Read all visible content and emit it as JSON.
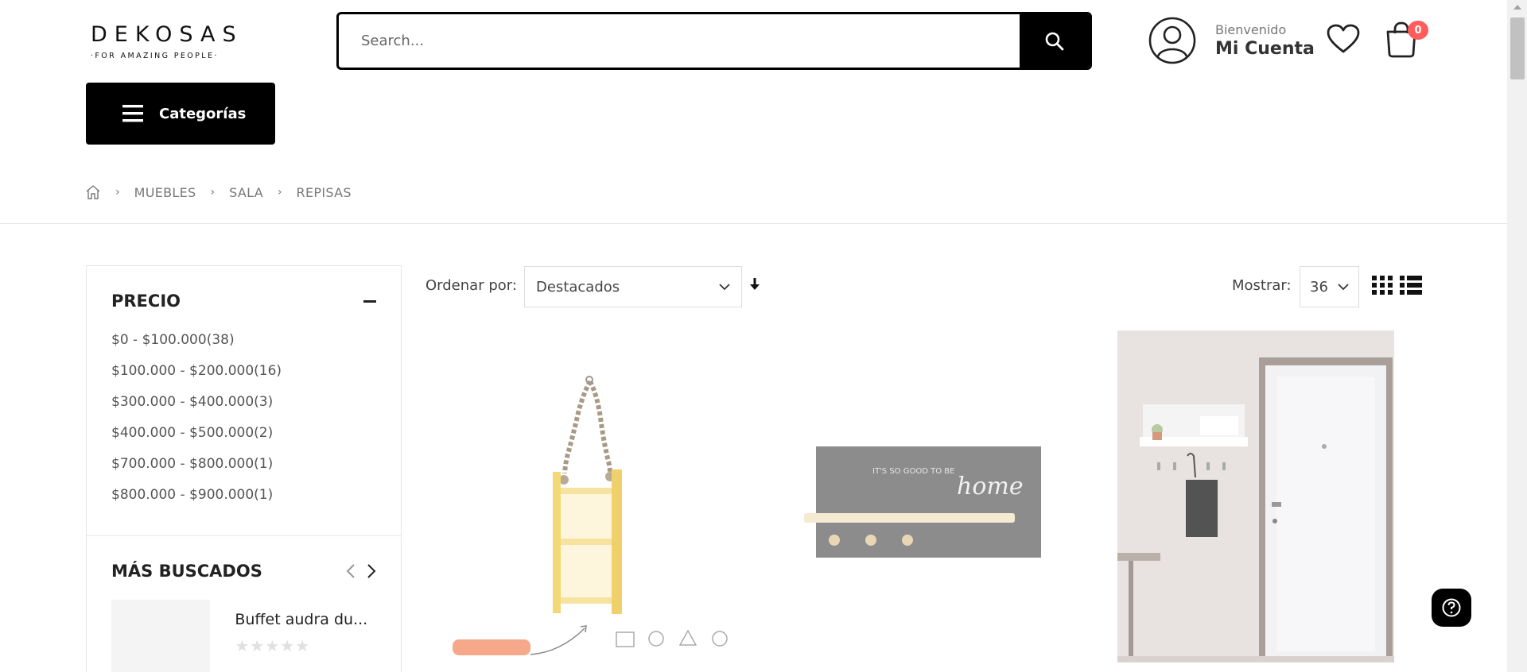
{
  "header": {
    "logo_main": "DEKOSAS",
    "logo_sub": "·FOR AMAZING PEOPLE·",
    "search_placeholder": "Search...",
    "welcome": "Bienvenido",
    "account_label": "Mi Cuenta",
    "cart_count": "0",
    "categories_label": "Categorías"
  },
  "breadcrumb": {
    "items": [
      "MUEBLES",
      "SALA",
      "REPISAS"
    ]
  },
  "filters": {
    "price_title": "PRECIO",
    "price_ranges": [
      "$0 - $100.000(38)",
      "$100.000 - $200.000(16)",
      "$300.000 - $400.000(3)",
      "$400.000 - $500.000(2)",
      "$700.000 - $800.000(1)",
      "$800.000 - $900.000(1)"
    ]
  },
  "most_searched": {
    "title": "MÁS BUSCADOS",
    "product_name": "Buffet audra du...",
    "rating": 0
  },
  "toolbar": {
    "order_label": "Ordenar por:",
    "order_value": "Destacados",
    "show_label": "Mostrar:",
    "show_value": "36"
  },
  "products": {
    "p2_text": "IT'S SO GOOD TO BE",
    "p2_script": "home"
  },
  "colors": {
    "badge": "#ff5c5c",
    "primary": "#000000"
  }
}
